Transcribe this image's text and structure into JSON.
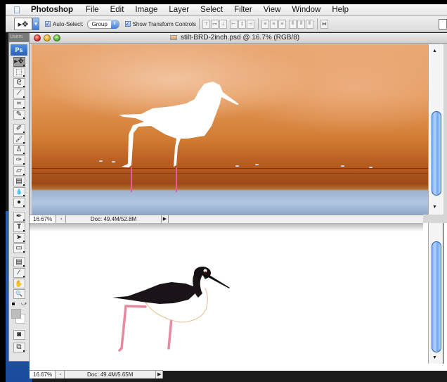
{
  "menubar": {
    "apple_icon": "apple-icon",
    "app_name": "Photoshop",
    "items": [
      "File",
      "Edit",
      "Image",
      "Layer",
      "Select",
      "Filter",
      "View",
      "Window",
      "Help"
    ]
  },
  "options_bar": {
    "tool_preset_icon": "move-tool-icon",
    "auto_select": {
      "label": "Auto-Select:",
      "checked": true
    },
    "auto_select_mode": {
      "selected": "Group"
    },
    "show_transform": {
      "label": "Show Transform Controls",
      "checked": true
    },
    "align_buttons": [
      "align-top",
      "align-vertical-center",
      "align-bottom",
      "align-left",
      "align-horizontal-center",
      "align-right"
    ],
    "distribute_buttons": [
      "distribute-top",
      "distribute-vertical-center",
      "distribute-bottom",
      "distribute-left",
      "distribute-horizontal-center",
      "distribute-right"
    ],
    "auto_align_button": "auto-align-layers"
  },
  "tools_panel": {
    "tab_label": "Users",
    "logo": "Ps",
    "tools": [
      {
        "name": "move-tool",
        "glyph": "▸✥",
        "active": true
      },
      {
        "name": "marquee-tool",
        "glyph": "⬚"
      },
      {
        "name": "lasso-tool",
        "glyph": "ᘓ"
      },
      {
        "name": "magic-wand-tool",
        "glyph": "⟋"
      },
      {
        "name": "crop-tool",
        "glyph": "⌗"
      },
      {
        "name": "slice-tool",
        "glyph": "✎"
      },
      {
        "name": "healing-brush-tool",
        "glyph": "✐"
      },
      {
        "name": "brush-tool",
        "glyph": "🖌"
      },
      {
        "name": "clone-stamp-tool",
        "glyph": "♙"
      },
      {
        "name": "history-brush-tool",
        "glyph": "✑"
      },
      {
        "name": "eraser-tool",
        "glyph": "▱"
      },
      {
        "name": "gradient-tool",
        "glyph": "▤"
      },
      {
        "name": "blur-tool",
        "glyph": "💧"
      },
      {
        "name": "dodge-tool",
        "glyph": "●"
      },
      {
        "name": "pen-tool",
        "glyph": "✒"
      },
      {
        "name": "type-tool",
        "glyph": "T"
      },
      {
        "name": "path-selection-tool",
        "glyph": "➤"
      },
      {
        "name": "rectangle-tool",
        "glyph": "▭"
      },
      {
        "name": "notes-tool",
        "glyph": "▤"
      },
      {
        "name": "eyedropper-tool",
        "glyph": "⁄"
      },
      {
        "name": "hand-tool",
        "glyph": "✋"
      },
      {
        "name": "zoom-tool",
        "glyph": "🔍"
      }
    ],
    "quick_mask_icon": "◙",
    "screen_mode_icon": "⧉"
  },
  "document_window_1": {
    "title": "stilt-BRD-2inch.psd @ 16.7% (RGB/8)",
    "zoom": "16.67%",
    "doc_info": "Doc: 49.4M/52.8M"
  },
  "document_window_2": {
    "zoom": "16.67%",
    "doc_info": "Doc: 49.4M/5.65M"
  },
  "colors": {
    "foreground": "#bdbdbd",
    "background": "#ffffff",
    "accent": "#3a7ad8"
  }
}
